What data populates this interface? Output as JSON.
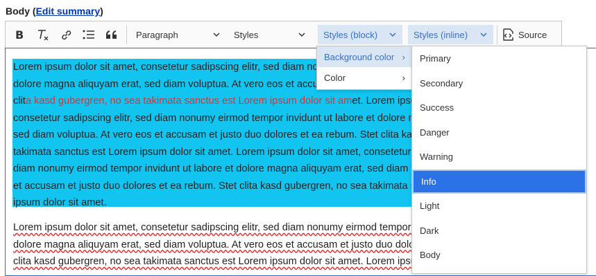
{
  "field": {
    "label": "Body",
    "paren_open": "(",
    "link": "Edit summary",
    "paren_close": ")"
  },
  "toolbar": {
    "paragraph": "Paragraph",
    "styles": "Styles",
    "styles_block": "Styles (block)",
    "styles_inline": "Styles (inline)",
    "source": "Source"
  },
  "block_menu": [
    {
      "label": "Background color",
      "arrow": "›"
    },
    {
      "label": "Color",
      "arrow": "›"
    }
  ],
  "color_menu": [
    "Primary",
    "Secondary",
    "Success",
    "Danger",
    "Warning",
    "Info",
    "Light",
    "Dark",
    "Body"
  ],
  "paragraph1": {
    "lines": [
      "Lorem ipsum dolor sit amet, consetetur sadipscing elitr, sed diam nonumy eirmod tempor invidunt ut labore et",
      "dolore magna aliquyam erat, sed diam voluptua. At vero eos et accusam et justo duo dolores et ea rebum. Stet",
      "",
      "consetetur sadipscing elitr, sed diam nonumy eirmod tempor invidunt ut labore et dolore magna aliquyam erat,",
      "sed diam voluptua. At vero eos et accusam et justo duo dolores et ea rebum. Stet clita kasd gubergren, no sea",
      "takimata sanctus est Lorem ipsum dolor sit amet. Lorem ipsum dolor sit amet, consetetur sadipscing elitr, sed",
      "diam nonumy eirmod tempor invidunt ut labore et dolore magna aliquyam erat, sed diam voluptua. At vero eos",
      "et accusam et justo duo dolores et ea rebum. Stet clita kasd gubergren, no sea takimata sanctus est Lorem",
      "ipsum dolor sit amet."
    ],
    "line3_a": "clit",
    "line3_red": "a kasd gubergren, no sea takimata sanctus est Lorem ipsum dolor sit am",
    "line3_b": "et. Lorem ipsum dolor sit amet,"
  },
  "paragraph2": {
    "lines": [
      "Lorem ipsum dolor sit amet, consetetur sadipscing elitr, sed diam nonumy eirmod tempor invidunt ut labore et",
      "dolore magna aliquyam erat, sed diam voluptua. At vero eos et accusam et justo duo dolores et ea rebum. Stet",
      "clita kasd gubergren, no sea takimata sanctus est Lorem ipsum dolor sit amet. Lorem ipsum dolor sit amet,"
    ]
  },
  "colors": {
    "highlight": "#12c4f0",
    "red_text": "#d3363a",
    "active_item": "#2b72e6"
  },
  "icons": [
    "bold-icon",
    "remove-format-icon",
    "link-icon",
    "bulleted-list-icon",
    "blockquote-icon",
    "source-icon",
    "chevron-down-icon"
  ]
}
